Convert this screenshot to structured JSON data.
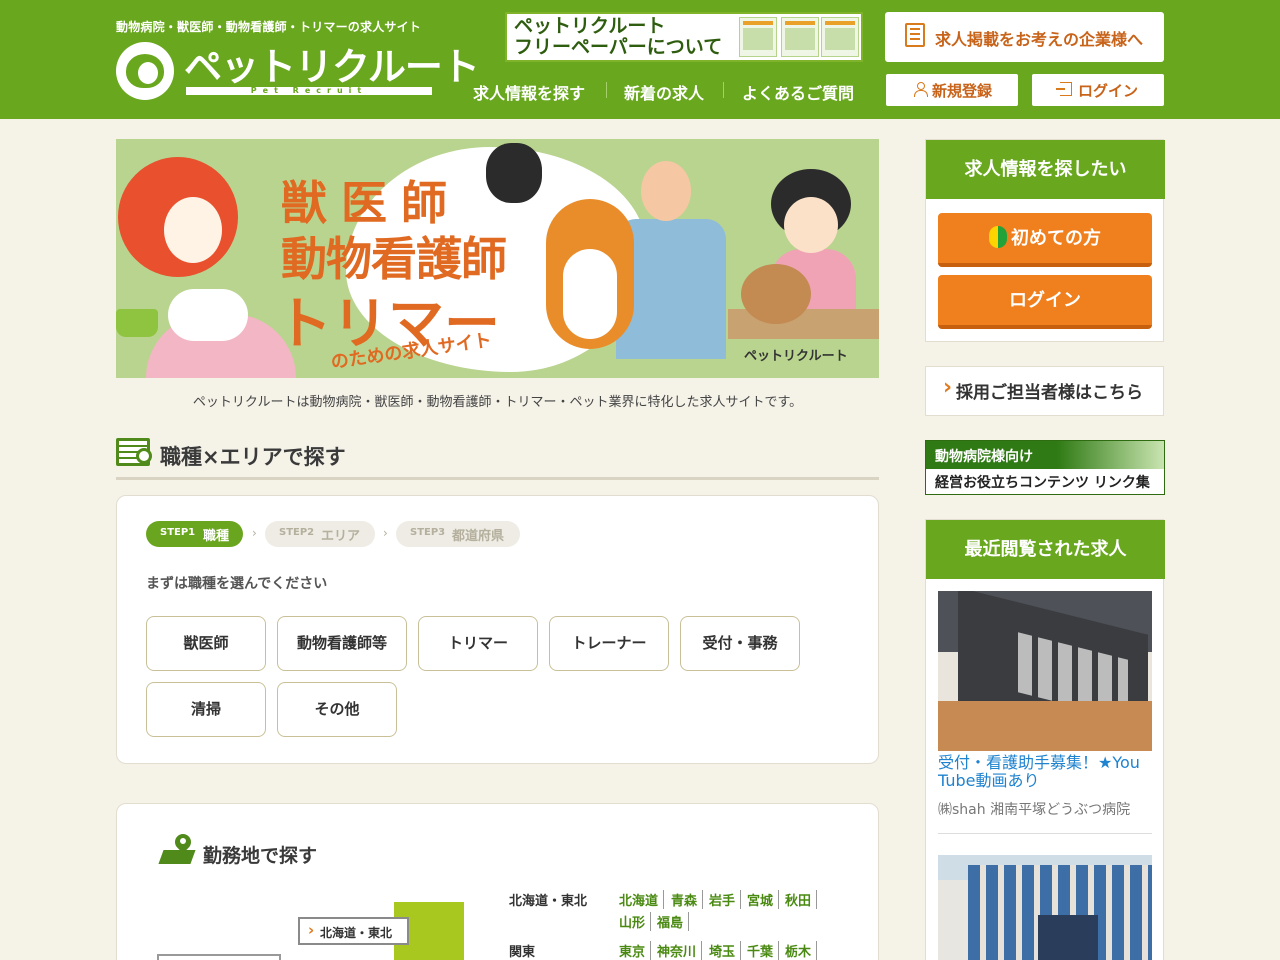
{
  "header": {
    "tagline": "動物病院・獣医師・動物看護師・トリマーの求人サイト",
    "logo_text": "ペットリクルート",
    "logo_sub": "Pet Recruit",
    "freepaper_line1": "ペットリクルート",
    "freepaper_line2": "フリーペーパーについて",
    "corp_button": "求人掲載をお考えの企業様へ",
    "nav": [
      "求人情報を探す",
      "新着の求人",
      "よくあるご質問"
    ],
    "register_button": "新規登録",
    "login_button": "ログイン"
  },
  "hero": {
    "line1": "獣医師",
    "line2": "動物看護師",
    "line3": "トリマー",
    "line4": "のための求人サイト",
    "mini_logo": "ペットリクルート"
  },
  "intro": "ペットリクルートは動物病院・獣医師・動物看護師・トリマー・ペット業界に特化した求人サイトです。",
  "search_section": {
    "title": "職種×エリアで探す",
    "steps": [
      {
        "num": "STEP1",
        "label": "職種"
      },
      {
        "num": "STEP2",
        "label": "エリア"
      },
      {
        "num": "STEP3",
        "label": "都道府県"
      }
    ],
    "lead": "まずは職種を選んでください",
    "jobs": [
      "獣医師",
      "動物看護師等",
      "トリマー",
      "トレーナー",
      "受付・事務",
      "清掃",
      "その他"
    ]
  },
  "area_section": {
    "title": "勤務地で探す",
    "map_label": "北海道・東北",
    "regions": [
      {
        "name": "北海道・東北",
        "prefs": [
          "北海道",
          "青森",
          "岩手",
          "宮城",
          "秋田",
          "山形",
          "福島"
        ]
      },
      {
        "name": "関東",
        "prefs": [
          "東京",
          "神奈川",
          "埼玉",
          "千葉",
          "栃木"
        ]
      }
    ]
  },
  "sidebar": {
    "search_head": "求人情報を探したい",
    "first_button": "初めての方",
    "login_button": "ログイン",
    "tanto_link": "採用ご担当者様はこちら",
    "biz_banner_line1": "動物病院様向け",
    "biz_banner_line2": "経営お役立ちコンテンツ リンク集",
    "recent_head": "最近閲覧された求人",
    "recent": [
      {
        "title": "受付・看護助手募集！★You Tube動画あり",
        "shop": "㈱shah 湘南平塚どうぶつ病院"
      }
    ]
  },
  "colors": {
    "brand_green": "#69a81e",
    "accent_orange": "#f0801e",
    "link_blue": "#1f83cf"
  }
}
